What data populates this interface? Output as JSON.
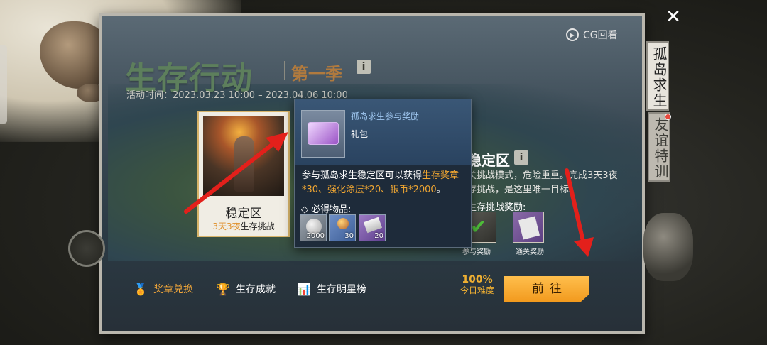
{
  "window": {
    "close_symbol": "✕",
    "cg_replay_label": "CG回看"
  },
  "event": {
    "title": "生存行动",
    "season": "第一季",
    "time_label": "活动时间：",
    "time_range": "2023.03.23 10:00 – 2023.04.06 10:00"
  },
  "side_tabs": [
    {
      "label": "孤岛求生"
    },
    {
      "label": "友谊特训"
    }
  ],
  "mode_card": {
    "name": "稳定区",
    "sub_highlight": "3天3夜",
    "sub_rest": "生存挑战"
  },
  "popup": {
    "item_name": "孤岛求生参与奖励",
    "item_type": "礼包",
    "desc_prefix": "参与孤岛求生稳定区可以获得",
    "desc_rewards": "生存奖章*30、强化涂层*20、银币*2000",
    "desc_suffix": "。",
    "must_label": "◇ 必得物品:",
    "items": [
      {
        "qty": "2000",
        "icon": "silver-coin-icon"
      },
      {
        "qty": "30",
        "icon": "survival-medal-icon"
      },
      {
        "qty": "20",
        "icon": "reinforced-coating-icon"
      }
    ]
  },
  "mode_detail": {
    "title": "稳定区",
    "desc_line1": "关挑战模式，危险重重。完成3天3夜",
    "desc_line2": "存挑战，是这里唯一目标。",
    "reward_label": "生存挑战奖励:",
    "reward_participate_caption": "参与奖励",
    "reward_clear_caption": "通关奖励"
  },
  "bottom_bar": {
    "medal_exchange": "奖章兑换",
    "achievements": "生存成就",
    "leaderboard": "生存明星榜",
    "difficulty_value": "100%",
    "difficulty_label": "今日难度",
    "go_button": "前往"
  },
  "colors": {
    "accent_orange": "#f29a1e",
    "highlight_text": "#f0a632",
    "title_green": "#5d7f5c",
    "annotation_red": "#e3201b"
  }
}
